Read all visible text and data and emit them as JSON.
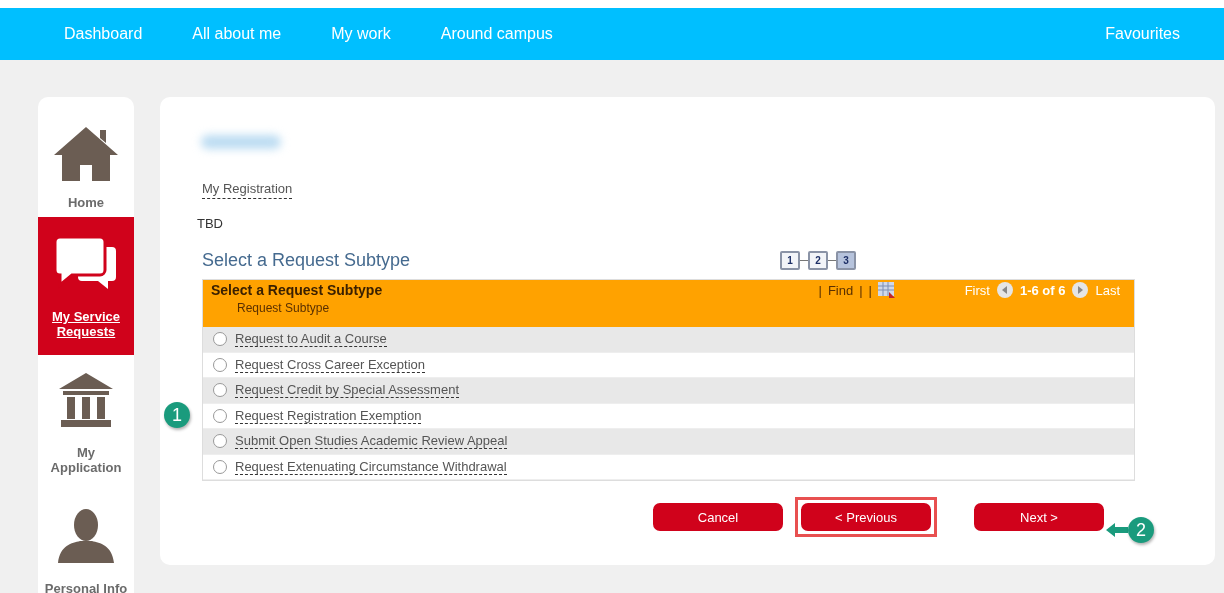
{
  "nav": {
    "items": [
      {
        "label": "Dashboard"
      },
      {
        "label": "All about me"
      },
      {
        "label": "My work"
      },
      {
        "label": "Around campus"
      }
    ],
    "favourites": "Favourites"
  },
  "sidebar": {
    "items": [
      {
        "kind": "home",
        "label": "Home",
        "selected": false
      },
      {
        "kind": "chat",
        "label": "My Service Requests",
        "selected": true
      },
      {
        "kind": "building",
        "label": "My Application",
        "selected": false
      },
      {
        "kind": "person",
        "label": "Personal Info",
        "selected": false
      }
    ]
  },
  "breadcrumb": "My Registration",
  "status": "TBD",
  "title": "Select a Request Subtype",
  "steps": [
    {
      "label": "1",
      "selected": false
    },
    {
      "label": "2",
      "selected": false
    },
    {
      "label": "3",
      "selected": true
    }
  ],
  "grid": {
    "title": "Select a Request Subtype",
    "separators": [
      "|",
      "|",
      "|"
    ],
    "find": "Find",
    "first": "First",
    "range": "1-6 of 6",
    "last": "Last",
    "column": "Request Subtype",
    "rows": [
      {
        "label": "Request to Audit a Course",
        "selected": false
      },
      {
        "label": "Request Cross Career Exception",
        "selected": false
      },
      {
        "label": "Request Credit by Special Assessment",
        "selected": false
      },
      {
        "label": "Request Registration Exemption",
        "selected": false
      },
      {
        "label": "Submit Open Studies Academic Review Appeal",
        "selected": false
      },
      {
        "label": "Request Extenuating Circumstance Withdrawal",
        "selected": false
      }
    ]
  },
  "buttons": [
    {
      "label": "Cancel",
      "highlighted": false
    },
    {
      "label": "< Previous",
      "highlighted": true
    },
    {
      "label": "Next >",
      "highlighted": false
    }
  ],
  "callouts": [
    {
      "label": "1"
    },
    {
      "label": "2"
    }
  ]
}
